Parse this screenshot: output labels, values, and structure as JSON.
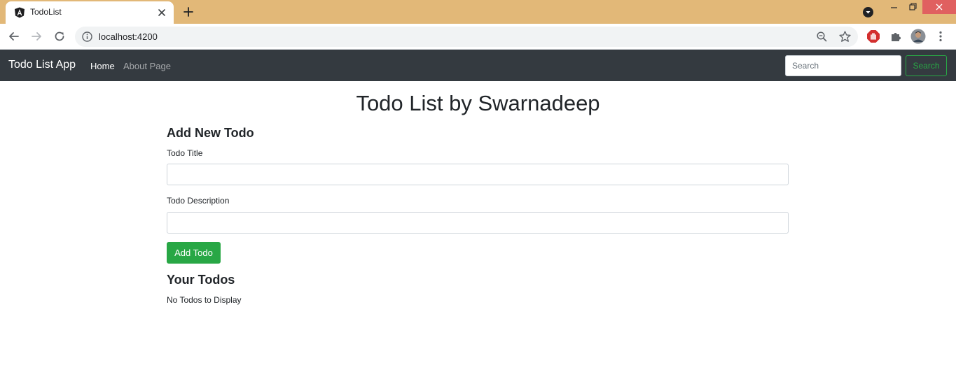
{
  "browser": {
    "tab_title": "TodoList",
    "url": "localhost:4200",
    "icons": {
      "favicon": "angular-icon",
      "close_tab": "close-icon",
      "new_tab": "plus-icon",
      "back": "arrow-left-icon",
      "forward": "arrow-right-icon",
      "reload": "reload-icon",
      "site_info": "info-icon",
      "zoom": "zoom-icon",
      "bookmark": "star-icon",
      "extension_block": "stop-hand-icon",
      "extensions": "puzzle-icon",
      "profile": "avatar",
      "menu": "kebab-menu-icon"
    },
    "colors": {
      "tabstrip": "#e2b878",
      "close": "#e06060"
    }
  },
  "navbar": {
    "brand": "Todo List App",
    "links": [
      {
        "label": "Home",
        "active": true
      },
      {
        "label": "About Page",
        "active": false
      }
    ],
    "search_placeholder": "Search",
    "search_button": "Search",
    "colors": {
      "background": "#343a40",
      "accent": "#28a745"
    }
  },
  "main": {
    "title": "Todo List by Swarnadeep",
    "add_section": {
      "heading": "Add New Todo",
      "title_label": "Todo Title",
      "title_value": "",
      "description_label": "Todo Description",
      "description_value": "",
      "submit_label": "Add Todo"
    },
    "list_section": {
      "heading": "Your Todos",
      "empty_message": "No Todos to Display"
    }
  }
}
